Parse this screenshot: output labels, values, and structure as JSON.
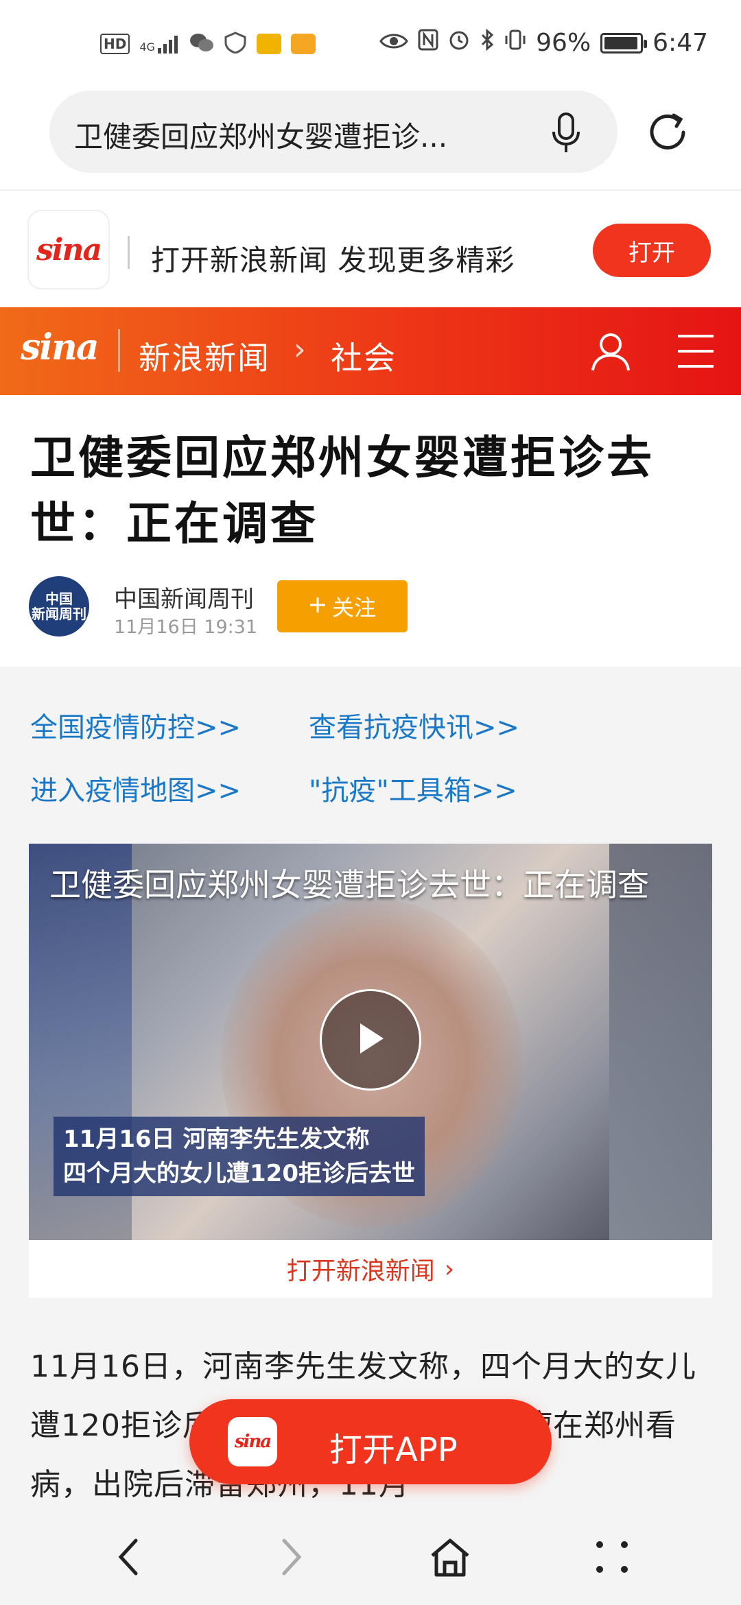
{
  "status_bar": {
    "battery_percent_text": "96%",
    "battery_level": 0.96,
    "time": "6:47",
    "network": "4G",
    "hd_badge": "HD",
    "icons": [
      "wechat-icon",
      "shield-icon",
      "mail-icon",
      "app-icon",
      "eye-icon",
      "nfc-icon",
      "alarm-icon",
      "bluetooth-icon",
      "vibrate-icon",
      "battery-icon"
    ]
  },
  "search": {
    "query": "卫健委回应郑州女婴遭拒诊..."
  },
  "app_banner": {
    "logo": "sina",
    "text": "打开新浪新闻 发现更多精彩",
    "open_label": "打开"
  },
  "nav": {
    "logo": "sina",
    "title": "新浪新闻",
    "separator": "›",
    "category": "社会"
  },
  "article": {
    "headline": "卫健委回应郑州女婴遭拒诊去世：正在调查",
    "author": "中国新闻周刊",
    "avatar_text": "中国\n新闻周刊",
    "time": "11月16日  19:31",
    "follow_label": "关注",
    "body": "11月16日，河南李先生发文称，四个月大的女儿遭120拒诊后去世。女儿此前因血管瘤在郑州看病，出院后滞留郑州，11月"
  },
  "quick_links": [
    "全国疫情防控>>",
    "查看抗疫快讯>>",
    "进入疫情地图>>",
    "\"抗疫\"工具箱>>"
  ],
  "video": {
    "title": "卫健委回应郑州女婴遭拒诊去世：正在调查",
    "caption_line1": "11月16日 河南李先生发文称",
    "caption_line2": "四个月大的女儿遭120拒诊后去世",
    "open_label": "打开新浪新闻",
    "open_chevron": "›"
  },
  "float_app": {
    "label": "打开APP"
  },
  "colors": {
    "accent_red": "#f0341e",
    "link_blue": "#1a78c8",
    "follow_orange": "#f5a000"
  }
}
